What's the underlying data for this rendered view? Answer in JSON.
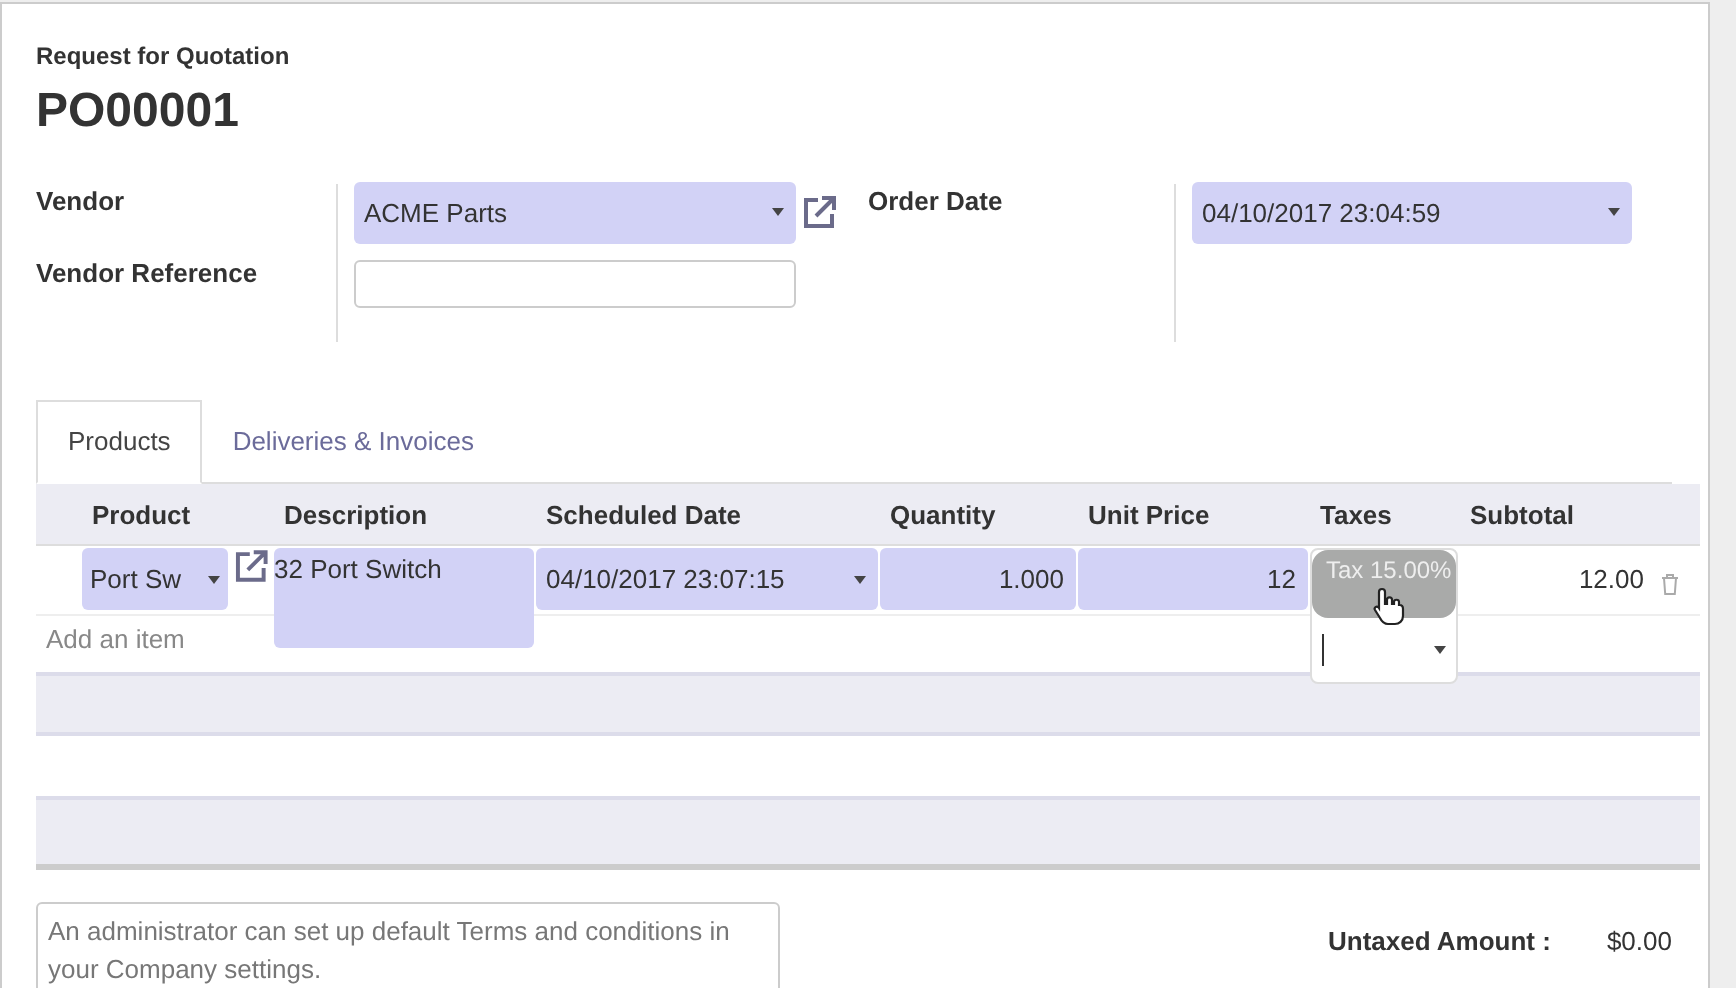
{
  "document": {
    "type_label": "Request for Quotation",
    "number": "PO00001"
  },
  "left_fields": [
    {
      "label": "Vendor",
      "kind": "select",
      "value": "ACME Parts",
      "link": true
    },
    {
      "label": "Vendor Reference",
      "kind": "text"
    }
  ],
  "right_fields": [
    {
      "label": "Order Date",
      "kind": "select",
      "value": "04/10/2017 23:04:59",
      "link": false
    }
  ],
  "tabs": [
    {
      "label": "Products",
      "selected": true
    },
    {
      "label": "Deliveries & Invoices",
      "selected": false
    }
  ],
  "table": {
    "columns": [
      "Product",
      "Description",
      "Scheduled Date",
      "Quantity",
      "Unit Price",
      "Taxes",
      "Subtotal"
    ],
    "rows": [
      {
        "product": "Port Sw",
        "description": "32 Port Switch",
        "scheduled_date": "04/10/2017 23:07:15",
        "quantity": "1.000",
        "unit_price": "12",
        "taxes": [
          "Tax 15.00%"
        ],
        "subtotal": "12.00"
      }
    ],
    "add_item": "Add an item"
  },
  "notes": {
    "placeholder": "An administrator can set up default Terms and conditions in your Company settings."
  },
  "totals": [
    {
      "label": "Untaxed Amount :",
      "value": "$0.00"
    }
  ]
}
